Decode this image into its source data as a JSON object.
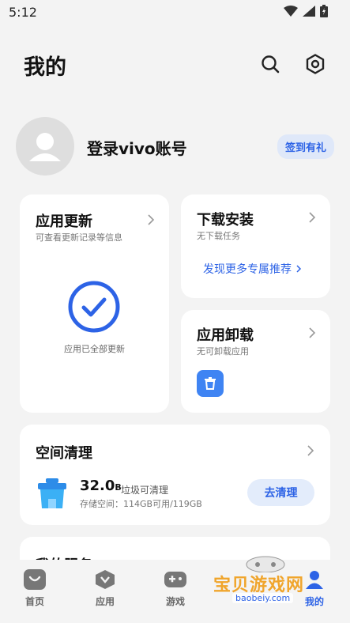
{
  "status_bar": {
    "time": "5:12"
  },
  "header": {
    "title": "我的"
  },
  "profile": {
    "login_text": "登录vivo账号",
    "sign_badge": "签到有礼"
  },
  "update_card": {
    "title": "应用更新",
    "subtitle": "可查看更新记录等信息",
    "status": "应用已全部更新"
  },
  "download_card": {
    "title": "下载安装",
    "subtitle": "无下载任务",
    "link": "发现更多专属推荐"
  },
  "uninstall_card": {
    "title": "应用卸载",
    "subtitle": "无可卸载应用"
  },
  "space_card": {
    "title": "空间清理",
    "size_value": "32.0",
    "size_unit": "B",
    "junk_label": "垃圾可清理",
    "storage_text": "存储空间：114GB可用/119GB",
    "clean_button": "去清理"
  },
  "service_card": {
    "title": "我的服务"
  },
  "bottom_nav": {
    "items": [
      {
        "label": "首页",
        "icon": "home-icon"
      },
      {
        "label": "应用",
        "icon": "apps-icon"
      },
      {
        "label": "游戏",
        "icon": "gamepad-icon"
      },
      {
        "label": "我的",
        "icon": "profile-icon"
      }
    ]
  },
  "watermark": {
    "title": "宝贝游戏网",
    "subtitle": "baobeiy.com"
  },
  "colors": {
    "accent": "#2d63e6",
    "icon_blue": "#3f84f3"
  }
}
